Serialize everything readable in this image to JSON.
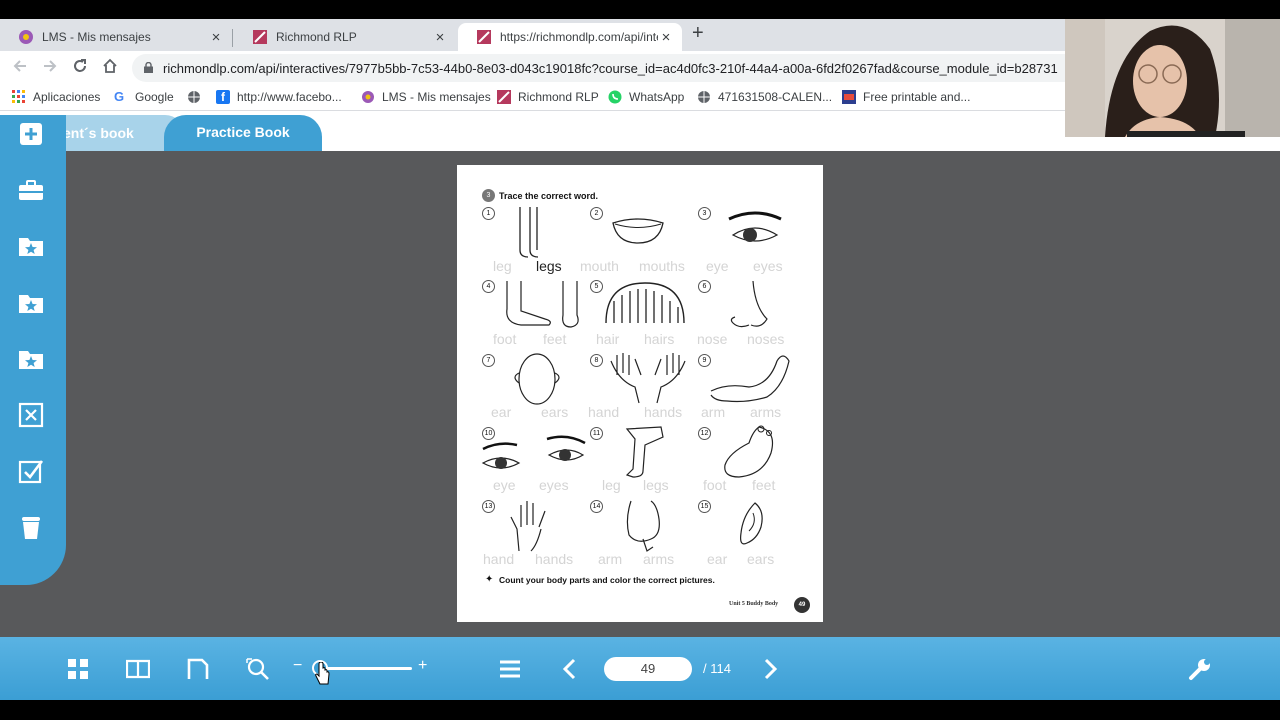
{
  "browser": {
    "tabs": [
      {
        "title": "LMS - Mis mensajes",
        "close": "×"
      },
      {
        "title": "Richmond RLP",
        "close": "×"
      },
      {
        "title": "https://richmondlp.com/api/inte",
        "close": "×"
      }
    ],
    "new_tab": "+",
    "url": "richmondlp.com/api/interactives/7977b5bb-7c53-44b0-8e03-d043c19018fc?course_id=ac4d0fc3-210f-44a4-a00a-6fd2f0267fad&course_module_id=b28731",
    "bookmarks": [
      "Aplicaciones",
      "Google",
      "http://www.facebo...",
      "LMS - Mis mensajes",
      "Richmond RLP",
      "WhatsApp",
      "471631508-CALEN...",
      "Free printable and..."
    ]
  },
  "app": {
    "tab_student": "ent´s book",
    "tab_practice": "Practice Book",
    "worksheet": {
      "exercise_title": "Trace the correct word.",
      "items": [
        {
          "num": "1",
          "w1": "leg",
          "w2": "legs"
        },
        {
          "num": "2",
          "w1": "mouth",
          "w2": "mouths"
        },
        {
          "num": "3",
          "w1": "eye",
          "w2": "eyes"
        },
        {
          "num": "4",
          "w1": "foot",
          "w2": "feet"
        },
        {
          "num": "5",
          "w1": "hair",
          "w2": "hairs"
        },
        {
          "num": "6",
          "w1": "nose",
          "w2": "noses"
        },
        {
          "num": "7",
          "w1": "ear",
          "w2": "ears"
        },
        {
          "num": "8",
          "w1": "hand",
          "w2": "hands"
        },
        {
          "num": "9",
          "w1": "arm",
          "w2": "arms"
        },
        {
          "num": "10",
          "w1": "eye",
          "w2": "eyes"
        },
        {
          "num": "11",
          "w1": "leg",
          "w2": "legs"
        },
        {
          "num": "12",
          "w1": "foot",
          "w2": "feet"
        },
        {
          "num": "13",
          "w1": "hand",
          "w2": "hands"
        },
        {
          "num": "14",
          "w1": "arm",
          "w2": "arms"
        },
        {
          "num": "15",
          "w1": "ear",
          "w2": "ears"
        }
      ],
      "footer_instruction": "Count your body parts and color the correct pictures.",
      "unit_label": "Unit 5  Buddy Body",
      "page_badge": "49"
    },
    "toolbar": {
      "page_number": "49",
      "page_total": "/ 114",
      "zoom_minus": "−",
      "zoom_plus": "+"
    }
  },
  "colors": {
    "app_blue": "#3fa0d3",
    "app_light_blue": "#a8d3ea",
    "viewer_bg": "#58595b"
  }
}
